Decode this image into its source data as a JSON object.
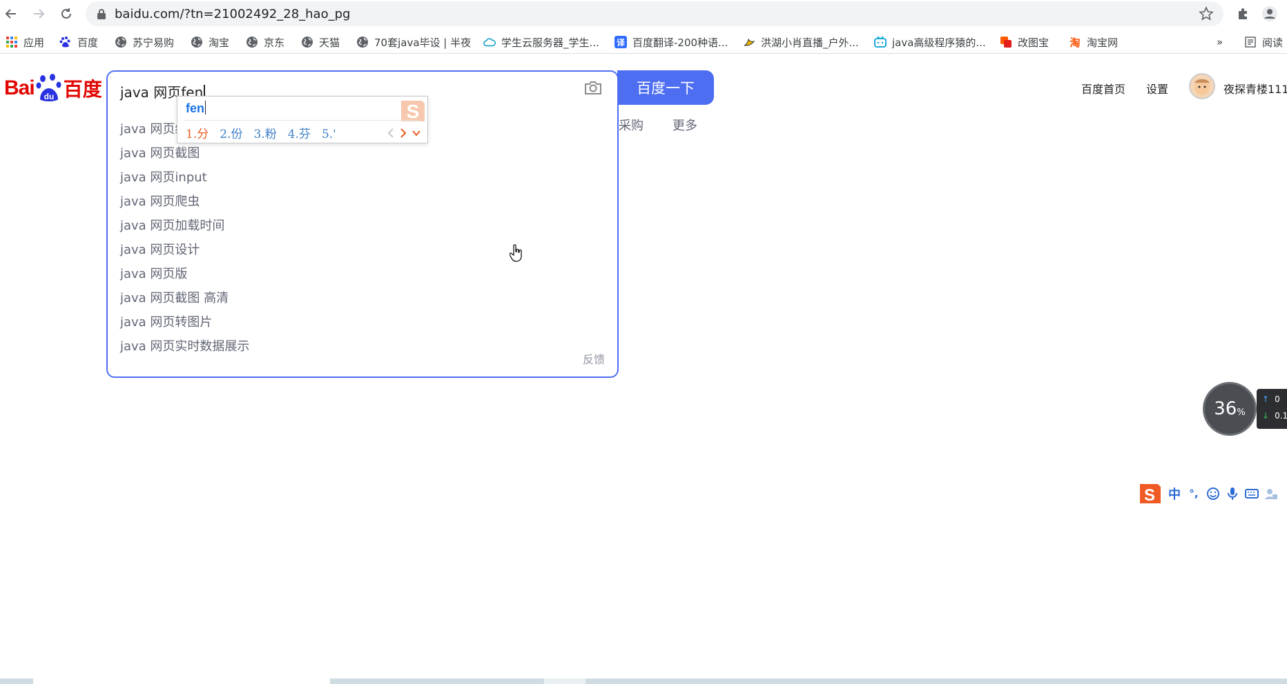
{
  "browser": {
    "url": "baidu.com/?tn=21002492_28_hao_pg",
    "bookmarks": [
      {
        "label": "应用",
        "icon": "apps-grid-icon"
      },
      {
        "label": "百度",
        "icon": "baidu-paw-icon"
      },
      {
        "label": "苏宁易购",
        "icon": "globe-icon"
      },
      {
        "label": "淘宝",
        "icon": "globe-icon"
      },
      {
        "label": "京东",
        "icon": "globe-icon"
      },
      {
        "label": "天猫",
        "icon": "globe-icon"
      },
      {
        "label": "70套java毕设 | 半夜",
        "icon": "globe-icon"
      },
      {
        "label": "学生云服务器_学生...",
        "icon": "cloud-icon"
      },
      {
        "label": "百度翻译-200种语...",
        "icon": "translate-icon"
      },
      {
        "label": "洪湖小肖直播_户外...",
        "icon": "bird-icon"
      },
      {
        "label": "java高级程序猿的...",
        "icon": "bilibili-icon"
      },
      {
        "label": "改图宝",
        "icon": "gaitubao-icon"
      },
      {
        "label": "淘宝网",
        "icon": "taobao-icon"
      }
    ],
    "overflow_label": "»",
    "reading_list_label": "阅读"
  },
  "baidu": {
    "logo_text_left": "Bai",
    "logo_text_mid": "du",
    "logo_text_right": "百度",
    "search_query": "java 网页fen",
    "search_button": "百度一下",
    "feedback": "反馈",
    "suggestions": [
      "java 网页编",
      "java 网页截图",
      "java 网页input",
      "java 网页爬虫",
      "java 网页加载时间",
      "java 网页设计",
      "java 网页版",
      "java 网页截图 高清",
      "java 网页转图片",
      "java 网页实时数据展示"
    ],
    "tabs_behind": {
      "purchase": "采购",
      "more": "更多"
    },
    "top_links": {
      "home": "百度首页",
      "settings": "设置",
      "username": "夜探青楼111"
    }
  },
  "ime": {
    "composition": "fen",
    "candidates": [
      "1.分",
      "2.份",
      "3.粉",
      "4.芬",
      "5.'"
    ]
  },
  "speed_widget": {
    "percent": "36",
    "unit": "%",
    "upload": "0",
    "download": "0.1"
  },
  "ime_toolbar": {
    "mode": "中",
    "punct": "°,"
  }
}
